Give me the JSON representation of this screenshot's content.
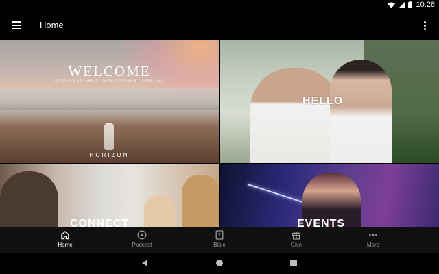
{
  "status_bar": {
    "time": "10:26",
    "icons": [
      "wifi-icon",
      "signal-icon",
      "battery-icon"
    ]
  },
  "app_bar": {
    "title": "Home",
    "menu_icon": "hamburger-menu-icon",
    "overflow_icon": "more-vertical-icon"
  },
  "tiles": {
    "welcome": {
      "title": "WELCOME",
      "subtitle": "CHRIST CENTERED · SPIRIT DRIVEN · LOVE LED",
      "logo_text": "HORIZON"
    },
    "hello": {
      "label": "HELLO"
    },
    "connect": {
      "label": "CONNECT"
    },
    "events": {
      "label": "EVENTS"
    }
  },
  "bottom_nav": {
    "items": [
      {
        "label": "Home",
        "icon": "home-icon",
        "active": true
      },
      {
        "label": "Podcast",
        "icon": "play-circle-icon",
        "active": false
      },
      {
        "label": "Bible",
        "icon": "bible-icon",
        "active": false
      },
      {
        "label": "Give",
        "icon": "gift-icon",
        "active": false
      },
      {
        "label": "More",
        "icon": "more-horizontal-icon",
        "active": false
      }
    ]
  },
  "system_nav": [
    "back-icon",
    "home-circle-icon",
    "recents-icon"
  ],
  "colors": {
    "background": "#000000",
    "nav_background": "#101010",
    "active": "#ffffff",
    "inactive": "#9a9a9a"
  }
}
